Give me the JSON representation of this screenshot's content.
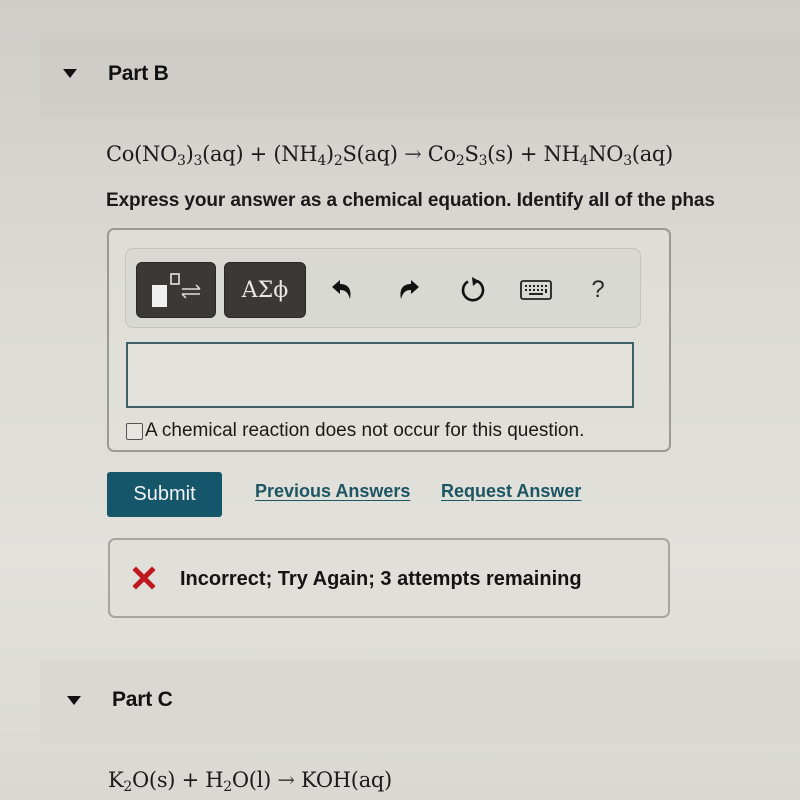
{
  "part_b": {
    "title": "Part B",
    "equation": {
      "reactant1": {
        "base": "Co(NO",
        "sub1": "3",
        "mid": ")",
        "sub2": "3",
        "phase": "(aq)"
      },
      "plus1": " + ",
      "reactant2": {
        "open": "(NH",
        "sub1": "4",
        "close": ")",
        "sub2": "2",
        "rest": "S",
        "phase": "(aq)"
      },
      "arrow": " → ",
      "product1": {
        "a": "Co",
        "sub1": "2",
        "b": "S",
        "sub2": "3",
        "phase": "(s)"
      },
      "plus2": " + ",
      "product2": {
        "a": "NH",
        "sub1": "4",
        "b": "NO",
        "sub2": "3",
        "phase": "(aq)"
      }
    },
    "instructions": "Express your answer as a chemical equation. Identify all of the phas",
    "toolbar": {
      "templates_icon": "templates-icon",
      "symbols_label": "ΑΣϕ",
      "undo_icon": "undo-icon",
      "redo_icon": "redo-icon",
      "reset_icon": "reset-icon",
      "keyboard_icon": "keyboard-icon",
      "help_label": "?"
    },
    "answer_value": "",
    "no_reaction_label": "A chemical reaction does not occur for this question.",
    "no_reaction_checked": false,
    "submit_label": "Submit",
    "previous_answers_label": "Previous Answers",
    "request_answer_label": "Request Answer",
    "feedback": {
      "status": "incorrect",
      "text": "Incorrect; Try Again; 3 attempts remaining",
      "color": "#c0181e"
    }
  },
  "part_c": {
    "title": "Part C",
    "equation": {
      "r1": {
        "a": "K",
        "sub": "2",
        "b": "O",
        "phase": "(s)"
      },
      "plus": " + ",
      "r2": {
        "a": "H",
        "sub": "2",
        "b": "O",
        "phase": "(l)"
      },
      "arrow": " → ",
      "p1": {
        "a": "KOH",
        "phase": "(aq)"
      }
    }
  },
  "colors": {
    "submit_bg": "#15566a",
    "link": "#1d5563",
    "toolbar_dark": "#3a3938",
    "input_border": "#3e5f66"
  }
}
